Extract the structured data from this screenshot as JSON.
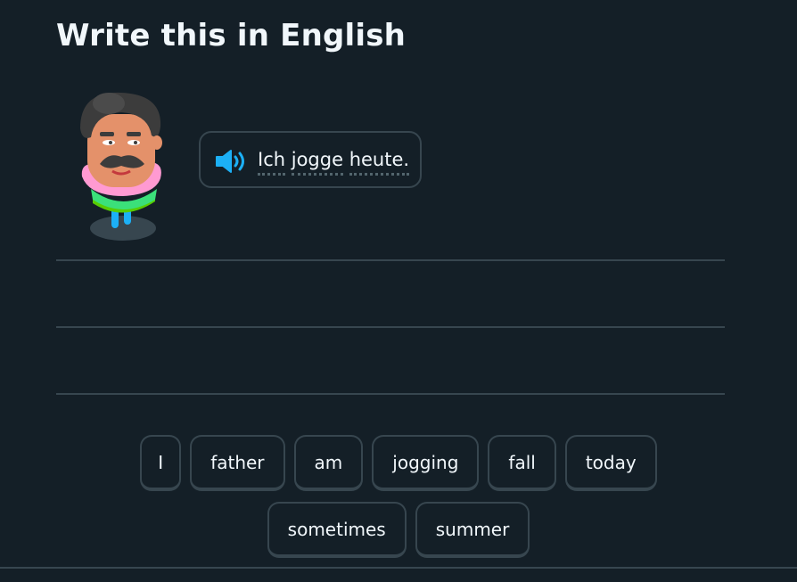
{
  "header": {
    "title": "Write this in English"
  },
  "prompt": {
    "words": [
      "Ich",
      "jogge",
      "heute."
    ],
    "speaker_icon": "speaker-icon"
  },
  "character": {
    "icon": "character-avatar"
  },
  "word_bank": {
    "row1": [
      "I",
      "father",
      "am",
      "jogging",
      "fall",
      "today"
    ],
    "row2": [
      "sometimes",
      "summer"
    ]
  },
  "colors": {
    "background": "#141f27",
    "border": "#37464f",
    "text": "#f1f7fb",
    "speaker": "#1cb0f6"
  }
}
